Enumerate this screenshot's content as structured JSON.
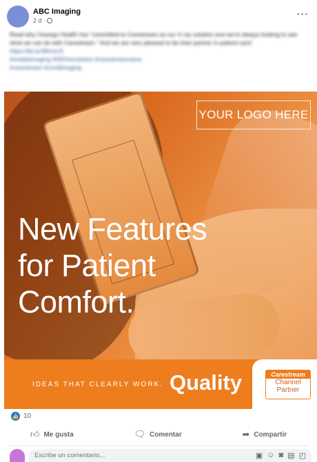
{
  "post": {
    "author": "ABC Imaging",
    "time": "2 d ·",
    "more": "···",
    "caption": "Read why Oswego Health has \"committed to Carestream as our X-ray solution and we're always looking to see what we can do with Carestream.\" And we are very pleased to be their partner in patient care!",
    "link": "https://bit.ly/38mnLl5",
    "hashtags1": "#mobileimaging #DRXrevolution #carestreamcares",
    "hashtags2": "#carestream #covidimaging"
  },
  "ad": {
    "logo_placeholder": "YOUR LOGO HERE",
    "headline": [
      "New Features",
      "for Patient",
      "Comfort."
    ],
    "tagline": "IDEAS THAT CLEARLY WORK.",
    "quality": "Quality",
    "partner_brand": "Carestream",
    "partner_line1": "Channel",
    "partner_line2": "Partner"
  },
  "reactions": {
    "count": "10",
    "icon": "thumbs-up-icon"
  },
  "actions": {
    "like": "Me gusta",
    "comment": "Comentar",
    "share": "Compartir"
  },
  "comment_box": {
    "placeholder": "Escribe un comentario..."
  },
  "colors": {
    "accent": "#ee7d1e",
    "link": "#1877f2"
  }
}
